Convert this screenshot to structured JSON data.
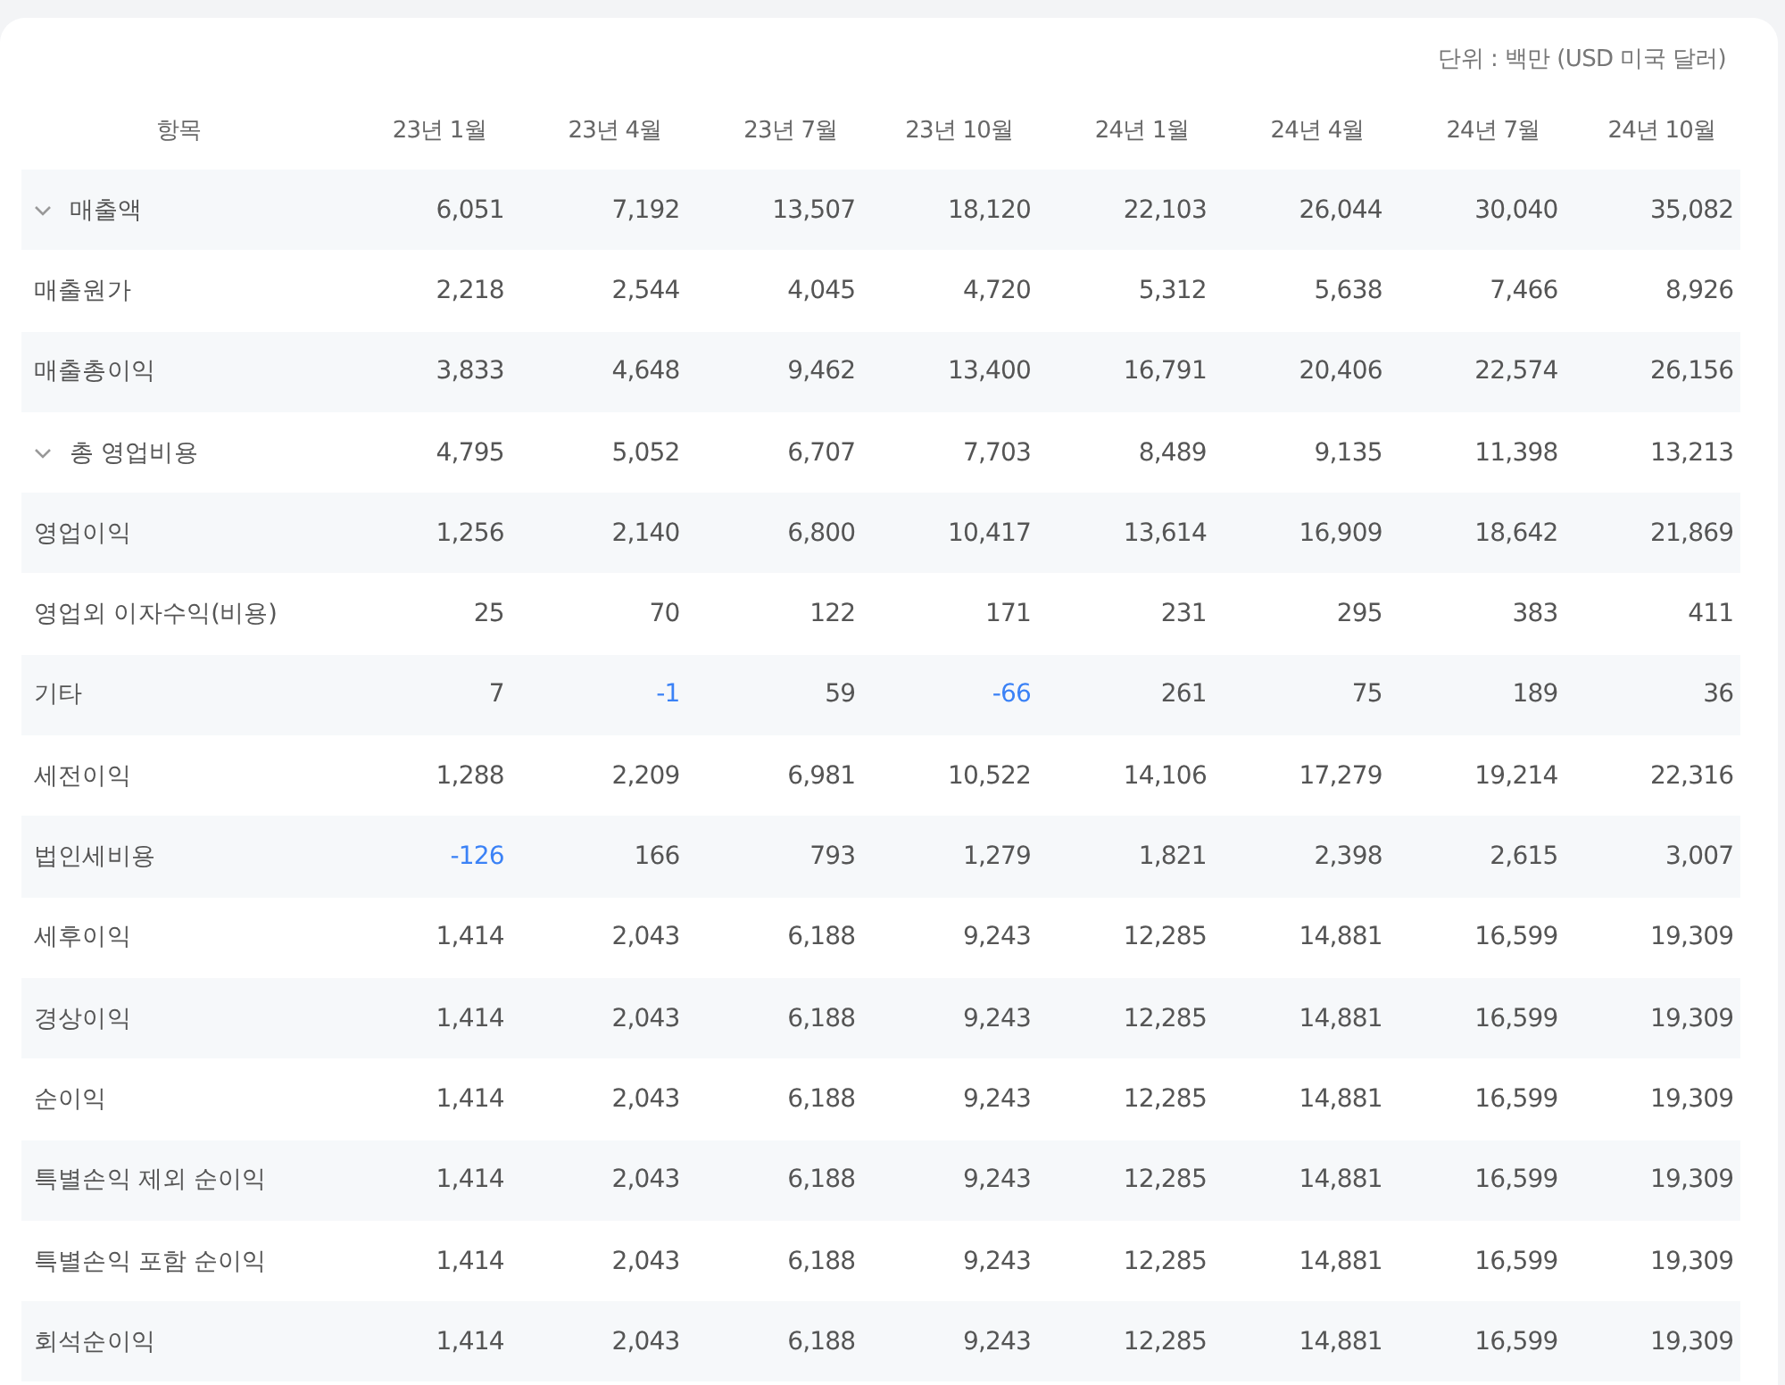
{
  "unit_note": "단위 : 백만 (USD 미국 달러)",
  "table": {
    "label_header": "항목",
    "columns": [
      "23년 1월",
      "23년 4월",
      "23년 7월",
      "23년 10월",
      "24년 1월",
      "24년 4월",
      "24년 7월",
      "24년 10월"
    ],
    "rows": [
      {
        "kind": "group",
        "expanded": true,
        "label": "매출액",
        "cells": [
          {
            "text": "6,051",
            "negative": false
          },
          {
            "text": "7,192",
            "negative": false
          },
          {
            "text": "13,507",
            "negative": false
          },
          {
            "text": "18,120",
            "negative": false
          },
          {
            "text": "22,103",
            "negative": false
          },
          {
            "text": "26,044",
            "negative": false
          },
          {
            "text": "30,040",
            "negative": false
          },
          {
            "text": "35,082",
            "negative": false
          }
        ]
      },
      {
        "kind": "item",
        "label": "매출원가",
        "cells": [
          {
            "text": "2,218",
            "negative": false
          },
          {
            "text": "2,544",
            "negative": false
          },
          {
            "text": "4,045",
            "negative": false
          },
          {
            "text": "4,720",
            "negative": false
          },
          {
            "text": "5,312",
            "negative": false
          },
          {
            "text": "5,638",
            "negative": false
          },
          {
            "text": "7,466",
            "negative": false
          },
          {
            "text": "8,926",
            "negative": false
          }
        ]
      },
      {
        "kind": "item",
        "label": "매출총이익",
        "cells": [
          {
            "text": "3,833",
            "negative": false
          },
          {
            "text": "4,648",
            "negative": false
          },
          {
            "text": "9,462",
            "negative": false
          },
          {
            "text": "13,400",
            "negative": false
          },
          {
            "text": "16,791",
            "negative": false
          },
          {
            "text": "20,406",
            "negative": false
          },
          {
            "text": "22,574",
            "negative": false
          },
          {
            "text": "26,156",
            "negative": false
          }
        ]
      },
      {
        "kind": "group",
        "expanded": true,
        "label": "총 영업비용",
        "cells": [
          {
            "text": "4,795",
            "negative": false
          },
          {
            "text": "5,052",
            "negative": false
          },
          {
            "text": "6,707",
            "negative": false
          },
          {
            "text": "7,703",
            "negative": false
          },
          {
            "text": "8,489",
            "negative": false
          },
          {
            "text": "9,135",
            "negative": false
          },
          {
            "text": "11,398",
            "negative": false
          },
          {
            "text": "13,213",
            "negative": false
          }
        ]
      },
      {
        "kind": "item",
        "label": "영업이익",
        "cells": [
          {
            "text": "1,256",
            "negative": false
          },
          {
            "text": "2,140",
            "negative": false
          },
          {
            "text": "6,800",
            "negative": false
          },
          {
            "text": "10,417",
            "negative": false
          },
          {
            "text": "13,614",
            "negative": false
          },
          {
            "text": "16,909",
            "negative": false
          },
          {
            "text": "18,642",
            "negative": false
          },
          {
            "text": "21,869",
            "negative": false
          }
        ]
      },
      {
        "kind": "item",
        "label": "영업외 이자수익(비용)",
        "cells": [
          {
            "text": "25",
            "negative": false
          },
          {
            "text": "70",
            "negative": false
          },
          {
            "text": "122",
            "negative": false
          },
          {
            "text": "171",
            "negative": false
          },
          {
            "text": "231",
            "negative": false
          },
          {
            "text": "295",
            "negative": false
          },
          {
            "text": "383",
            "negative": false
          },
          {
            "text": "411",
            "negative": false
          }
        ]
      },
      {
        "kind": "item",
        "label": "기타",
        "cells": [
          {
            "text": "7",
            "negative": false
          },
          {
            "text": "-1",
            "negative": true
          },
          {
            "text": "59",
            "negative": false
          },
          {
            "text": "-66",
            "negative": true
          },
          {
            "text": "261",
            "negative": false
          },
          {
            "text": "75",
            "negative": false
          },
          {
            "text": "189",
            "negative": false
          },
          {
            "text": "36",
            "negative": false
          }
        ]
      },
      {
        "kind": "item",
        "label": "세전이익",
        "cells": [
          {
            "text": "1,288",
            "negative": false
          },
          {
            "text": "2,209",
            "negative": false
          },
          {
            "text": "6,981",
            "negative": false
          },
          {
            "text": "10,522",
            "negative": false
          },
          {
            "text": "14,106",
            "negative": false
          },
          {
            "text": "17,279",
            "negative": false
          },
          {
            "text": "19,214",
            "negative": false
          },
          {
            "text": "22,316",
            "negative": false
          }
        ]
      },
      {
        "kind": "item",
        "label": "법인세비용",
        "cells": [
          {
            "text": "-126",
            "negative": true
          },
          {
            "text": "166",
            "negative": false
          },
          {
            "text": "793",
            "negative": false
          },
          {
            "text": "1,279",
            "negative": false
          },
          {
            "text": "1,821",
            "negative": false
          },
          {
            "text": "2,398",
            "negative": false
          },
          {
            "text": "2,615",
            "negative": false
          },
          {
            "text": "3,007",
            "negative": false
          }
        ]
      },
      {
        "kind": "item",
        "label": "세후이익",
        "cells": [
          {
            "text": "1,414",
            "negative": false
          },
          {
            "text": "2,043",
            "negative": false
          },
          {
            "text": "6,188",
            "negative": false
          },
          {
            "text": "9,243",
            "negative": false
          },
          {
            "text": "12,285",
            "negative": false
          },
          {
            "text": "14,881",
            "negative": false
          },
          {
            "text": "16,599",
            "negative": false
          },
          {
            "text": "19,309",
            "negative": false
          }
        ]
      },
      {
        "kind": "item",
        "label": "경상이익",
        "cells": [
          {
            "text": "1,414",
            "negative": false
          },
          {
            "text": "2,043",
            "negative": false
          },
          {
            "text": "6,188",
            "negative": false
          },
          {
            "text": "9,243",
            "negative": false
          },
          {
            "text": "12,285",
            "negative": false
          },
          {
            "text": "14,881",
            "negative": false
          },
          {
            "text": "16,599",
            "negative": false
          },
          {
            "text": "19,309",
            "negative": false
          }
        ]
      },
      {
        "kind": "item",
        "label": "순이익",
        "cells": [
          {
            "text": "1,414",
            "negative": false
          },
          {
            "text": "2,043",
            "negative": false
          },
          {
            "text": "6,188",
            "negative": false
          },
          {
            "text": "9,243",
            "negative": false
          },
          {
            "text": "12,285",
            "negative": false
          },
          {
            "text": "14,881",
            "negative": false
          },
          {
            "text": "16,599",
            "negative": false
          },
          {
            "text": "19,309",
            "negative": false
          }
        ]
      },
      {
        "kind": "item",
        "label": "특별손익 제외 순이익",
        "cells": [
          {
            "text": "1,414",
            "negative": false
          },
          {
            "text": "2,043",
            "negative": false
          },
          {
            "text": "6,188",
            "negative": false
          },
          {
            "text": "9,243",
            "negative": false
          },
          {
            "text": "12,285",
            "negative": false
          },
          {
            "text": "14,881",
            "negative": false
          },
          {
            "text": "16,599",
            "negative": false
          },
          {
            "text": "19,309",
            "negative": false
          }
        ]
      },
      {
        "kind": "item",
        "label": "특별손익 포함 순이익",
        "cells": [
          {
            "text": "1,414",
            "negative": false
          },
          {
            "text": "2,043",
            "negative": false
          },
          {
            "text": "6,188",
            "negative": false
          },
          {
            "text": "9,243",
            "negative": false
          },
          {
            "text": "12,285",
            "negative": false
          },
          {
            "text": "14,881",
            "negative": false
          },
          {
            "text": "16,599",
            "negative": false
          },
          {
            "text": "19,309",
            "negative": false
          }
        ]
      },
      {
        "kind": "item",
        "label": "회석순이익",
        "cells": [
          {
            "text": "1,414",
            "negative": false
          },
          {
            "text": "2,043",
            "negative": false
          },
          {
            "text": "6,188",
            "negative": false
          },
          {
            "text": "9,243",
            "negative": false
          },
          {
            "text": "12,285",
            "negative": false
          },
          {
            "text": "14,881",
            "negative": false
          },
          {
            "text": "16,599",
            "negative": false
          },
          {
            "text": "19,309",
            "negative": false
          }
        ]
      }
    ]
  }
}
